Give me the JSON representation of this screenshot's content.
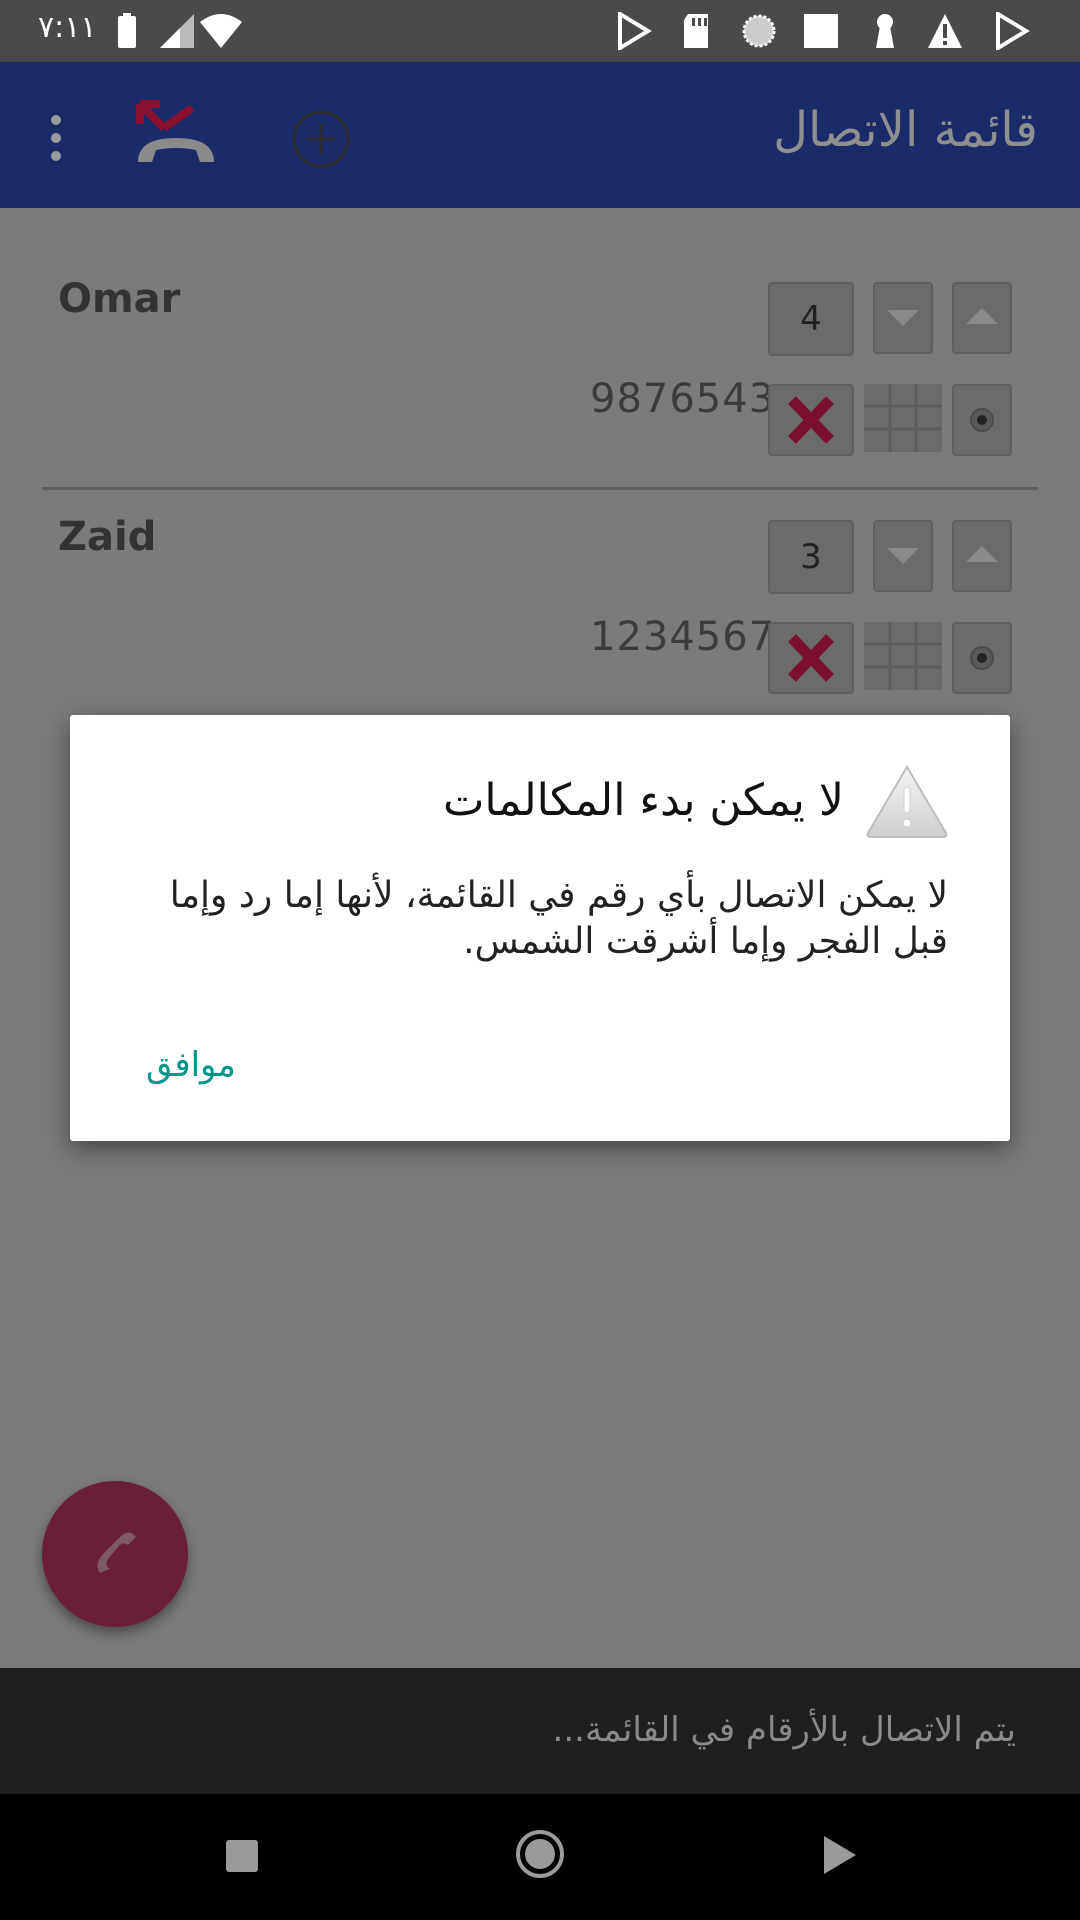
{
  "status_bar": {
    "time": "٧:١١",
    "icons": [
      "battery-icon",
      "signal-icon",
      "wifi-icon",
      "play-store-icon",
      "sd-card-icon",
      "sync-icon",
      "square-icon",
      "keyhole-icon",
      "warning-icon",
      "play-store-icon"
    ]
  },
  "app_bar": {
    "title": "قائمة الاتصال",
    "actions": [
      "overflow-menu-icon",
      "hangup-icon",
      "add-circle-icon"
    ]
  },
  "contacts": [
    {
      "name": "Omar",
      "phone": "9876543",
      "priority": "4"
    },
    {
      "name": "Zaid",
      "phone": "1234567",
      "priority": "3"
    }
  ],
  "dialog": {
    "title": "لا يمكن بدء المكالمات",
    "message": "لا يمكن الاتصال بأي رقم في القائمة، لأنها إما رد وإما قبل الفجر وإما أشرقت الشمس.",
    "ok_label": "موافق"
  },
  "snackbar": {
    "text": "يتم الاتصال بالأرقام في القائمة..."
  },
  "colors": {
    "app_bar": "#1b2b6a",
    "accent_ok": "#009688",
    "fab": "#6b1f36",
    "delete_x": "#7a0f2e"
  }
}
